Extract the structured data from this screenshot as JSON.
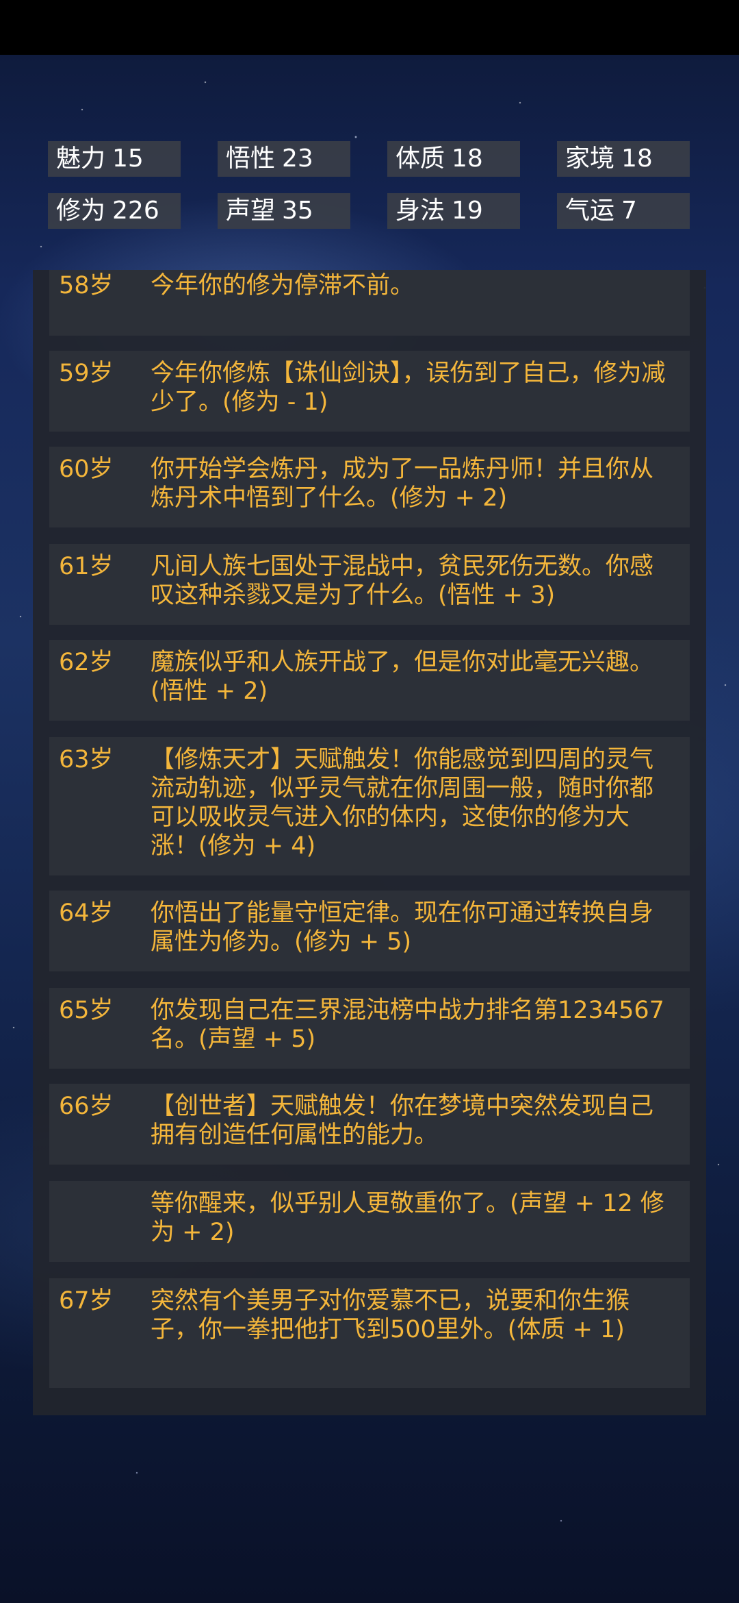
{
  "stats": [
    {
      "label": "魅力",
      "value": "15"
    },
    {
      "label": "悟性",
      "value": "23"
    },
    {
      "label": "体质",
      "value": "18"
    },
    {
      "label": "家境",
      "value": "18"
    },
    {
      "label": "修为",
      "value": "226"
    },
    {
      "label": "声望",
      "value": "35"
    },
    {
      "label": "身法",
      "value": "19"
    },
    {
      "label": "气运",
      "value": "7"
    }
  ],
  "log": [
    {
      "age": "58岁",
      "text": "今年你的修为停滞不前。"
    },
    {
      "age": "59岁",
      "text": "今年你修炼【诛仙剑诀】，误伤到了自己，修为减少了。(修为 - 1)"
    },
    {
      "age": "60岁",
      "text": "你开始学会炼丹，成为了一品炼丹师！并且你从炼丹术中悟到了什么。(修为 + 2)"
    },
    {
      "age": "61岁",
      "text": "凡间人族七国处于混战中，贫民死伤无数。你感叹这种杀戮又是为了什么。(悟性 + 3)"
    },
    {
      "age": "62岁",
      "text": "魔族似乎和人族开战了，但是你对此毫无兴趣。(悟性 + 2)"
    },
    {
      "age": "63岁",
      "text": "【修炼天才】天赋触发！你能感觉到四周的灵气流动轨迹，似乎灵气就在你周围一般，随时你都可以吸收灵气进入你的体内，这使你的修为大涨！(修为 + 4)"
    },
    {
      "age": "64岁",
      "text": "你悟出了能量守恒定律。现在你可通过转换自身属性为修为。(修为 + 5)"
    },
    {
      "age": "65岁",
      "text": "你发现自己在三界混沌榜中战力排名第1234567名。(声望 + 5)"
    },
    {
      "age": "66岁",
      "text": "【创世者】天赋触发！你在梦境中突然发现自己拥有创造任何属性的能力。"
    },
    {
      "age": "",
      "text": "等你醒来，似乎别人更敬重你了。(声望 + 12 修为 + 2)"
    },
    {
      "age": "67岁",
      "text": "突然有个美男子对你爱慕不已，说要和你生猴子，你一拳把他打飞到500里外。(体质 + 1)"
    }
  ]
}
